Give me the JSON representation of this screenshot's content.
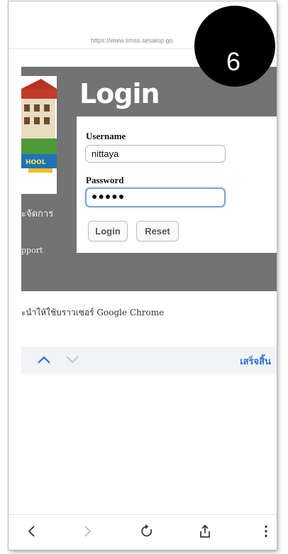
{
  "browser": {
    "url": "https://www.smss.sesalop.go."
  },
  "step_badge": {
    "number": "6"
  },
  "page": {
    "side_text_manage": "ะจัดการ",
    "side_text_support": "pport",
    "login_title": "Login",
    "username_label": "Username",
    "username_value": "nittaya",
    "password_label": "Password",
    "password_value": "●●●●●",
    "login_button": "Login",
    "reset_button": "Reset",
    "browser_recommendation": "ะนำให้ใช้บราวเซอร์ Google Chrome"
  },
  "find_bar": {
    "done_label": "เสร็จสิ้น"
  },
  "toolbar": {
    "icons": [
      "chevron-left-icon",
      "chevron-right-icon",
      "reload-icon",
      "share-icon",
      "more-icon"
    ]
  },
  "colors": {
    "accent": "#2c6fd1",
    "panel": "#737373",
    "badge": "#000000"
  }
}
